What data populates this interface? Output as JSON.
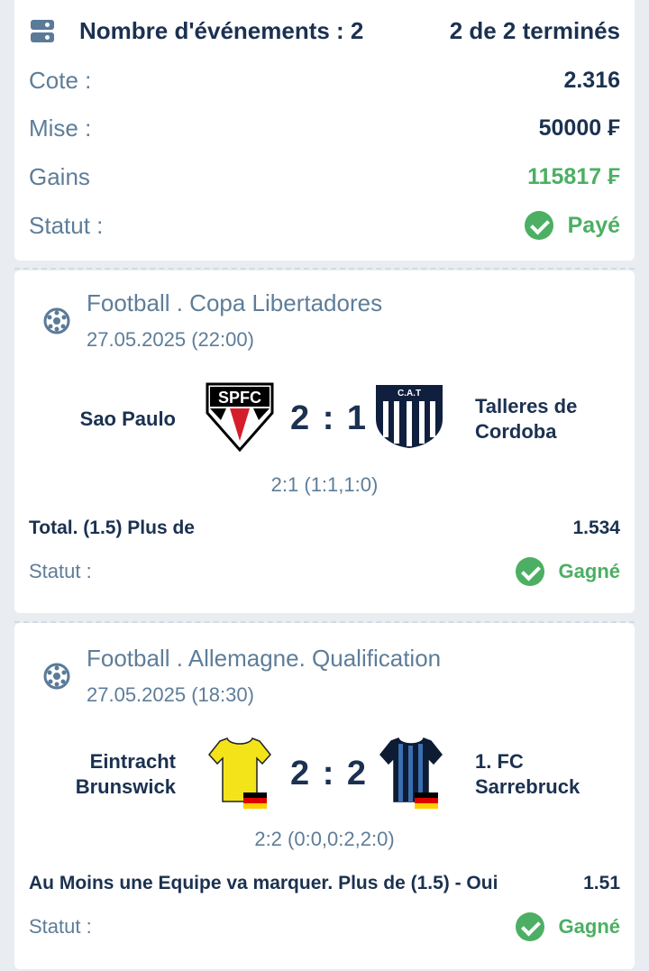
{
  "summary": {
    "title": "Nombre d'événements : 2",
    "progress": "2 de 2 terminés",
    "rows": [
      {
        "label": "Cote :",
        "value": "2.316"
      },
      {
        "label": "Mise :",
        "value": "50000 ₣"
      },
      {
        "label": "Gains",
        "value": "115817 ₣"
      },
      {
        "label": "Statut :",
        "value": "Payé"
      }
    ]
  },
  "events": [
    {
      "title": "Football . Copa Libertadores",
      "date": "27.05.2025 (22:00)",
      "home": "Sao Paulo",
      "away_line1": "Talleres de",
      "away_line2": "Cordoba",
      "home_logo_text": "SPFC",
      "away_logo_text": "C.A.T",
      "score": "2 : 1",
      "detail": "2:1 (1:1,1:0)",
      "market": "Total. (1.5) Plus de",
      "odd": "1.534",
      "status_label": "Statut :",
      "status": "Gagné"
    },
    {
      "title": "Football . Allemagne. Qualification",
      "date": "27.05.2025 (18:30)",
      "home_line1": "Eintracht",
      "home_line2": "Brunswick",
      "away_line1": "1. FC",
      "away_line2": "Sarrebruck",
      "score": "2 : 2",
      "detail": "2:2 (0:0,0:2,2:0)",
      "market": "Au Moins une Equipe va marquer. Plus de (1.5) - Oui",
      "odd": "1.51",
      "status_label": "Statut :",
      "status": "Gagné"
    }
  ],
  "colors": {
    "accent_green": "#4caf63",
    "text_dark": "#1b3150",
    "text_muted": "#5e7d99"
  }
}
